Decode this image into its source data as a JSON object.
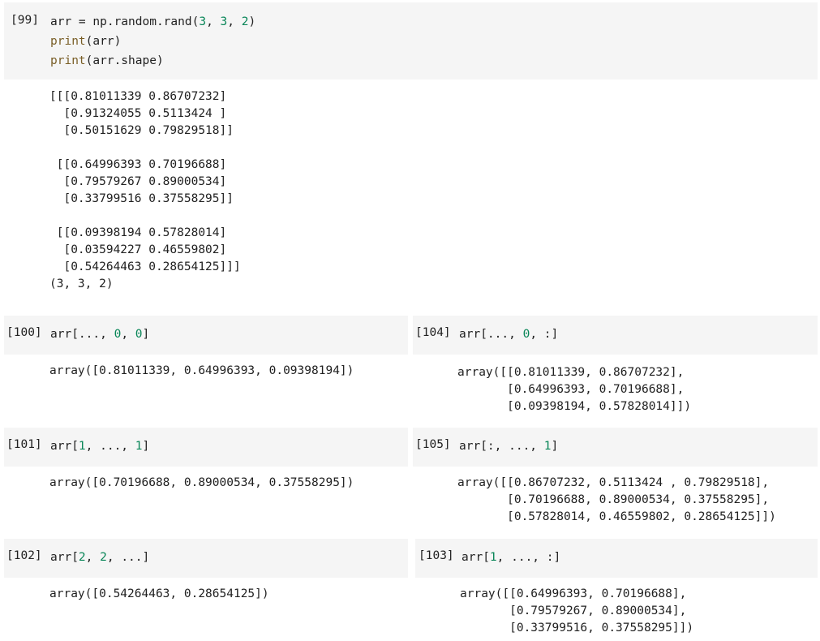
{
  "cells": {
    "c99": {
      "prompt": "[99]",
      "lines": [
        [
          {
            "t": "arr = np.random.rand(",
            "c": "p"
          },
          {
            "t": "3",
            "c": "n"
          },
          {
            "t": ", ",
            "c": "p"
          },
          {
            "t": "3",
            "c": "n"
          },
          {
            "t": ", ",
            "c": "p"
          },
          {
            "t": "2",
            "c": "n"
          },
          {
            "t": ")",
            "c": "p"
          }
        ],
        [
          {
            "t": "print",
            "c": "k"
          },
          {
            "t": "(arr)",
            "c": "p"
          }
        ],
        [
          {
            "t": "print",
            "c": "k"
          },
          {
            "t": "(arr.shape)",
            "c": "p"
          }
        ]
      ],
      "output": [
        "[[[0.81011339 0.86707232]",
        "  [0.91324055 0.5113424 ]",
        "  [0.50151629 0.79829518]]",
        "",
        " [[0.64996393 0.70196688]",
        "  [0.79579267 0.89000534]",
        "  [0.33799516 0.37558295]]",
        "",
        " [[0.09398194 0.57828014]",
        "  [0.03594227 0.46559802]",
        "  [0.54264463 0.28654125]]]",
        "(3, 3, 2)"
      ]
    },
    "c100": {
      "prompt": "[100]",
      "lines": [
        [
          {
            "t": "arr[..., ",
            "c": "p"
          },
          {
            "t": "0",
            "c": "n"
          },
          {
            "t": ", ",
            "c": "p"
          },
          {
            "t": "0",
            "c": "n"
          },
          {
            "t": "]",
            "c": "p"
          }
        ]
      ],
      "output": [
        "array([0.81011339, 0.64996393, 0.09398194])"
      ]
    },
    "c101": {
      "prompt": "[101]",
      "lines": [
        [
          {
            "t": "arr[",
            "c": "p"
          },
          {
            "t": "1",
            "c": "n"
          },
          {
            "t": ", ..., ",
            "c": "p"
          },
          {
            "t": "1",
            "c": "n"
          },
          {
            "t": "]",
            "c": "p"
          }
        ]
      ],
      "output": [
        "array([0.70196688, 0.89000534, 0.37558295])"
      ]
    },
    "c102": {
      "prompt": "[102]",
      "lines": [
        [
          {
            "t": "arr[",
            "c": "p"
          },
          {
            "t": "2",
            "c": "n"
          },
          {
            "t": ", ",
            "c": "p"
          },
          {
            "t": "2",
            "c": "n"
          },
          {
            "t": ", ...]",
            "c": "p"
          }
        ]
      ],
      "output": [
        "array([0.54264463, 0.28654125])"
      ]
    },
    "c104": {
      "prompt": "[104]",
      "lines": [
        [
          {
            "t": "arr[..., ",
            "c": "p"
          },
          {
            "t": "0",
            "c": "n"
          },
          {
            "t": ", :]",
            "c": "p"
          }
        ]
      ],
      "output": [
        "array([[0.81011339, 0.86707232],",
        "       [0.64996393, 0.70196688],",
        "       [0.09398194, 0.57828014]])"
      ]
    },
    "c105": {
      "prompt": "[105]",
      "lines": [
        [
          {
            "t": "arr[:, ..., ",
            "c": "p"
          },
          {
            "t": "1",
            "c": "n"
          },
          {
            "t": "]",
            "c": "p"
          }
        ]
      ],
      "output": [
        "array([[0.86707232, 0.5113424 , 0.79829518],",
        "       [0.70196688, 0.89000534, 0.37558295],",
        "       [0.57828014, 0.46559802, 0.28654125]])"
      ]
    },
    "c103": {
      "prompt": "[103]",
      "lines": [
        [
          {
            "t": "arr[",
            "c": "p"
          },
          {
            "t": "1",
            "c": "n"
          },
          {
            "t": ", ..., :]",
            "c": "p"
          }
        ]
      ],
      "output": [
        "array([[0.64996393, 0.70196688],",
        "       [0.79579267, 0.89000534],",
        "       [0.33799516, 0.37558295]])"
      ]
    }
  },
  "colors": {
    "keyword": "#795e26",
    "number": "#098658",
    "cell_bg": "#f5f5f5"
  }
}
